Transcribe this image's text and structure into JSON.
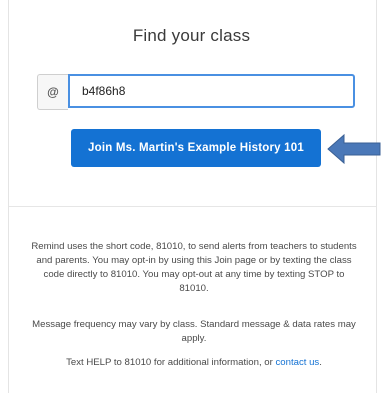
{
  "page": {
    "title": "Find your class"
  },
  "code_entry": {
    "prefix": "@",
    "value": "b4f86h8"
  },
  "join_button": {
    "label": "Join Ms. Martin's Example History 101",
    "color": "#1472d3"
  },
  "annotation": {
    "icon": "arrow-left-icon",
    "color": "#4a78b8"
  },
  "info": {
    "paragraph1": "Remind uses the short code, 81010, to send alerts from teachers to students and parents. You may opt-in by using this Join page or by texting the class code directly to 81010. You may opt-out at any time by texting STOP to 81010.",
    "paragraph2": "Message frequency may vary by class. Standard message & data rates may apply.",
    "paragraph3_prefix": "Text HELP to 81010 for additional information, or ",
    "contact_link": "contact us",
    "paragraph3_suffix": "."
  }
}
